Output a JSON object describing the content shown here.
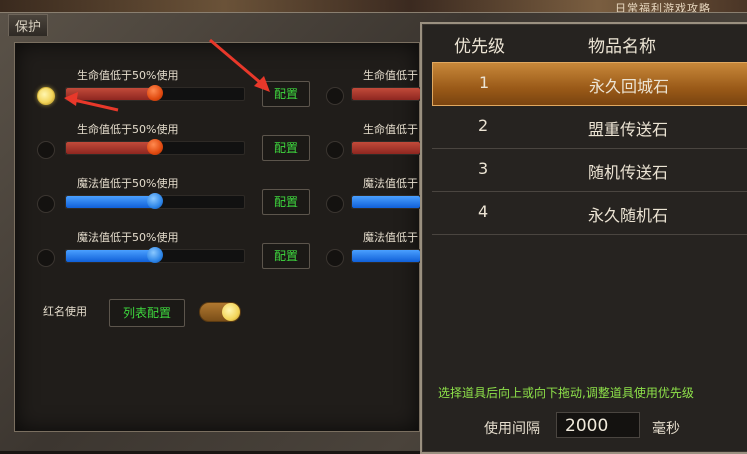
{
  "window": {
    "title": "保护",
    "banner_text": "日常福利游戏攻略"
  },
  "colors": {
    "accent_green": "#3ed83e",
    "hint_green": "#8ee24a",
    "hp_red": "#b8382c",
    "mp_blue": "#2e86e8",
    "selected_row": "#b07030"
  },
  "rows": [
    {
      "label": "生命值低于50%使用",
      "radio_on": true,
      "level": 0.5,
      "color": "red",
      "config_label": "配置"
    },
    {
      "label": "生命值低于50%使用",
      "radio_on": false,
      "level": 0.5,
      "color": "red",
      "config_label": "配置"
    },
    {
      "label": "魔法值低于50%使用",
      "radio_on": false,
      "level": 0.5,
      "color": "blue",
      "config_label": "配置"
    },
    {
      "label": "魔法值低于50%使用",
      "radio_on": false,
      "level": 0.5,
      "color": "blue",
      "config_label": "配置"
    }
  ],
  "right_rows": [
    {
      "label": "生命值低于"
    },
    {
      "label": "生命值低于"
    },
    {
      "label": "魔法值低于"
    },
    {
      "label": "魔法值低于"
    }
  ],
  "red_name": {
    "label": "红名使用",
    "list_button": "列表配置",
    "toggle_on": true
  },
  "popup": {
    "header_priority": "优先级",
    "header_name": "物品名称",
    "items": [
      {
        "priority": "1",
        "name": "永久回城石",
        "selected": true
      },
      {
        "priority": "2",
        "name": "盟重传送石",
        "selected": false
      },
      {
        "priority": "3",
        "name": "随机传送石",
        "selected": false
      },
      {
        "priority": "4",
        "name": "永久随机石",
        "selected": false
      }
    ],
    "hint": "选择道具后向上或向下拖动,调整道具使用优先级",
    "interval_label": "使用间隔",
    "interval_value": "2000",
    "interval_unit": "毫秒"
  }
}
